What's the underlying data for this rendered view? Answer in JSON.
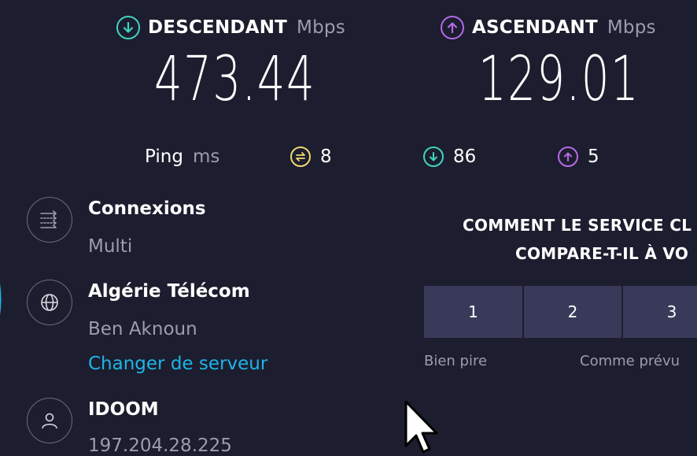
{
  "download": {
    "label": "DESCENDANT",
    "unit": "Mbps",
    "value": "473.44",
    "color": "#3fd6c0",
    "icon": "arrow-down-circle-icon"
  },
  "upload": {
    "label": "ASCENDANT",
    "unit": "Mbps",
    "value": "129.01",
    "color": "#b46ae8",
    "icon": "arrow-up-circle-icon"
  },
  "ping": {
    "label": "Ping",
    "unit": "ms",
    "idle": "8",
    "download": "86",
    "upload": "5",
    "idle_color": "#efd86f"
  },
  "server": {
    "connections_title": "Connexions",
    "connections_value": "Multi",
    "isp_name": "Algérie Télécom",
    "location": "Ben Aknoun",
    "change_server": "Changer de serveur",
    "host_title": "IDOOM",
    "ip": "197.204.28.225"
  },
  "rating": {
    "question_line1": "COMMENT LE SERVICE CL",
    "question_line2": "COMPARE-T-IL À VO",
    "options": [
      "1",
      "2",
      "3"
    ],
    "hint_low": "Bien pire",
    "hint_mid": "Comme prévu"
  }
}
